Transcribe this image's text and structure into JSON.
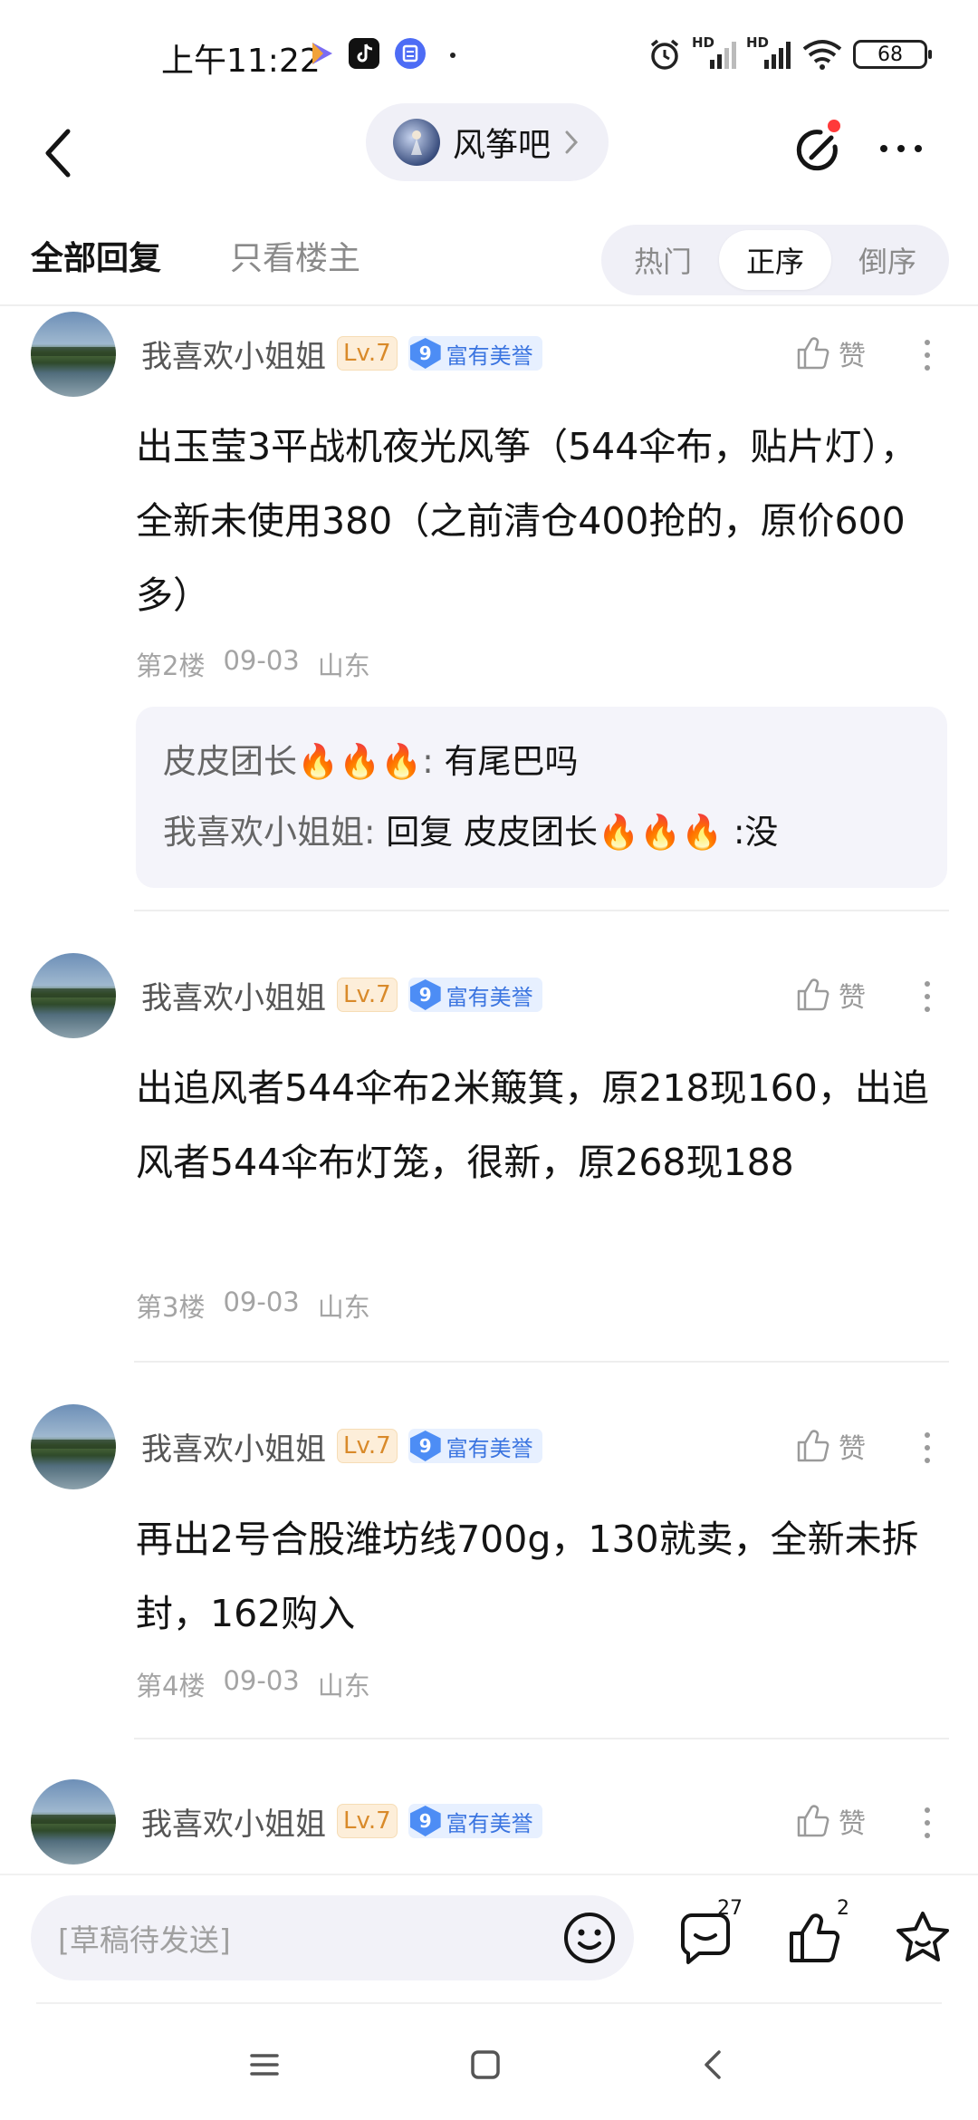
{
  "status_bar": {
    "time": "上午11:22",
    "battery": "68",
    "network_label_1": "HD",
    "network_label_2": "HD"
  },
  "header": {
    "forum_name": "风筝吧"
  },
  "tabs": {
    "all_replies": "全部回复",
    "owner_only": "只看楼主",
    "sort_options": [
      "热门",
      "正序",
      "倒序"
    ],
    "active_sort": "正序"
  },
  "posts": [
    {
      "username": "我喜欢小姐姐",
      "level": "Lv.7",
      "honor_num": "9",
      "honor_text": "富有美誉",
      "like_label": "赞",
      "content": "出玉莹3平战机夜光风筝（544伞布，贴片灯），全新未使用380（之前清仓400抢的，原价600多）",
      "floor": "第2楼",
      "date": "09-03",
      "location": "山东",
      "sub_replies": [
        {
          "author": "皮皮团长🔥🔥🔥",
          "text": "有尾巴吗"
        },
        {
          "author": "我喜欢小姐姐",
          "text": "回复 皮皮团长🔥🔥🔥 :没"
        }
      ]
    },
    {
      "username": "我喜欢小姐姐",
      "level": "Lv.7",
      "honor_num": "9",
      "honor_text": "富有美誉",
      "like_label": "赞",
      "content": "出追风者544伞布2米簸箕，原218现160，出追风者544伞布灯笼，很新，原268现188",
      "floor": "第3楼",
      "date": "09-03",
      "location": "山东"
    },
    {
      "username": "我喜欢小姐姐",
      "level": "Lv.7",
      "honor_num": "9",
      "honor_text": "富有美誉",
      "like_label": "赞",
      "content": "再出2号合股潍坊线700g，130就卖，全新未拆封，162购入",
      "floor": "第4楼",
      "date": "09-03",
      "location": "山东"
    },
    {
      "username": "我喜欢小姐姐",
      "level": "Lv.7",
      "honor_num": "9",
      "honor_text": "富有美誉",
      "like_label": "赞"
    }
  ],
  "bottom_bar": {
    "draft_placeholder": "[草稿待发送]",
    "comment_count": "27",
    "like_count": "2"
  },
  "icons": {
    "back": "back-arrow-icon",
    "edit": "edit-icon",
    "more": "more-icon",
    "emoji": "emoji-icon",
    "comment": "comment-icon",
    "thumbs_up": "thumbs-up-icon",
    "star": "star-icon"
  },
  "colors": {
    "accent_blue": "#4d8df5",
    "level_orange": "#d98a2a",
    "notification_red": "#ff3a3a",
    "sub_reply_bg": "#f4f4fa"
  }
}
